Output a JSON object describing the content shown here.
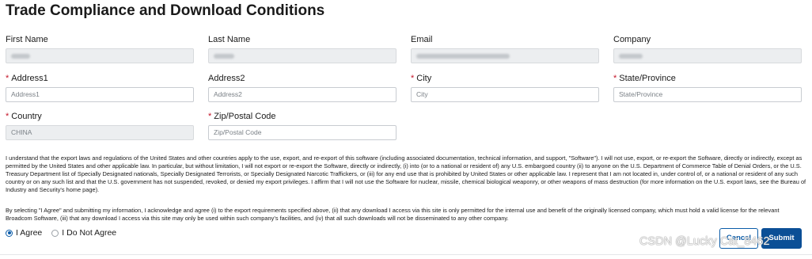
{
  "title": "Trade Compliance and Download Conditions",
  "fields": {
    "first_name": {
      "label": "First Name",
      "required": false,
      "value": "",
      "placeholder": ""
    },
    "last_name": {
      "label": "Last Name",
      "required": false,
      "value": "",
      "placeholder": ""
    },
    "email": {
      "label": "Email",
      "required": false,
      "value": "",
      "placeholder": ""
    },
    "company": {
      "label": "Company",
      "required": false,
      "value": "",
      "placeholder": ""
    },
    "address1": {
      "label": "Address1",
      "required": true,
      "value": "",
      "placeholder": "Address1"
    },
    "address2": {
      "label": "Address2",
      "required": false,
      "value": "",
      "placeholder": "Address2"
    },
    "city": {
      "label": "City",
      "required": true,
      "value": "",
      "placeholder": "City"
    },
    "state": {
      "label": "State/Province",
      "required": true,
      "value": "",
      "placeholder": "State/Province"
    },
    "country": {
      "label": "Country",
      "required": true,
      "value": "CHINA",
      "placeholder": ""
    },
    "zip": {
      "label": "Zip/Postal Code",
      "required": true,
      "value": "",
      "placeholder": "Zip/Postal Code"
    }
  },
  "required_marker": "*",
  "legal_text_1": "I understand that the export laws and regulations of the United States and other countries apply to the use, export, and re-export of this software (including associated documentation, technical information, and support, \"Software\"). I will not use, export, or re-export the Software, directly or indirectly, except as permitted by the United States and other applicable law. In particular, but without limitation, I will not export or re-export the Software, directly or indirectly, (i) into (or to a national or resident of) any U.S. embargoed country (ii) to anyone on the U.S. Department of Commerce Table of Denial Orders, or the U.S. Treasury Department list of Specially Designated nationals, Specially Designated Terrorists, or Specially Designated Narcotic Traffickers, or (iii) for any end use that is prohibited by United States or other applicable law. I represent that I am not located in, under control of, or a national or resident of any such country or on any such list and that the U.S. government has not suspended, revoked, or denied my export privileges. I affirm that I will not use the Software for nuclear, missile, chemical biological weaponry, or other weapons of mass destruction (for more information on the U.S. export laws, see the Bureau of Industry and Security's home page).",
  "legal_text_2": "By selecting \"I Agree\" and submitting my information, I acknowledge and agree (i) to the export requirements specified above, (ii) that any download I access via this site is only permitted for the internal use and benefit of the originally licensed company, which must hold a valid license for the relevant Broadcom Software, (iii) that any download I access via this site may only be used within such company’s facilities, and (iv) that all such downloads will not be disseminated to any other company.",
  "agree_options": [
    {
      "label": "I Agree",
      "selected": true
    },
    {
      "label": "I Do Not Agree",
      "selected": false
    }
  ],
  "buttons": {
    "cancel": "Cancel",
    "submit": "Submit"
  },
  "watermark": "CSDN @Lucky Cat_8462",
  "colors": {
    "accent": "#0b4f96",
    "required": "#c4162a"
  }
}
